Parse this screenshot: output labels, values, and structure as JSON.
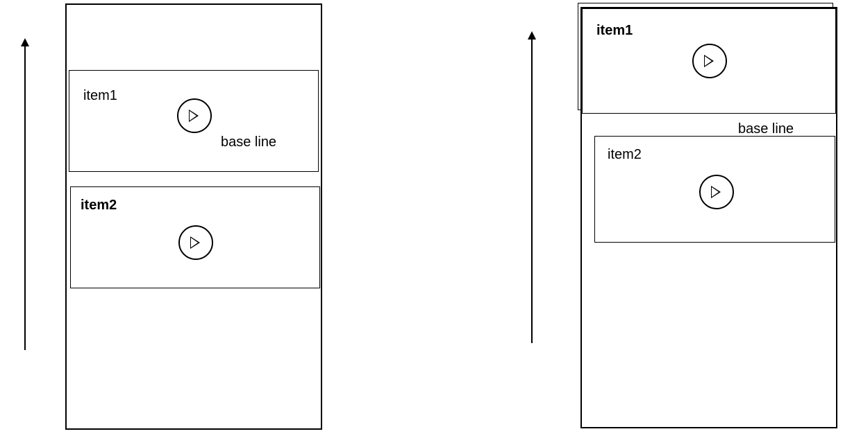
{
  "diagrams": {
    "left": {
      "items": [
        {
          "label": "item1",
          "bold": false
        },
        {
          "label": "item2",
          "bold": true
        }
      ],
      "baseline_label": "base line"
    },
    "right": {
      "items": [
        {
          "label": "item1",
          "bold": true
        },
        {
          "label": "item2",
          "bold": false
        }
      ],
      "baseline_label": "base line"
    }
  },
  "icons": {
    "play": "play-icon"
  }
}
